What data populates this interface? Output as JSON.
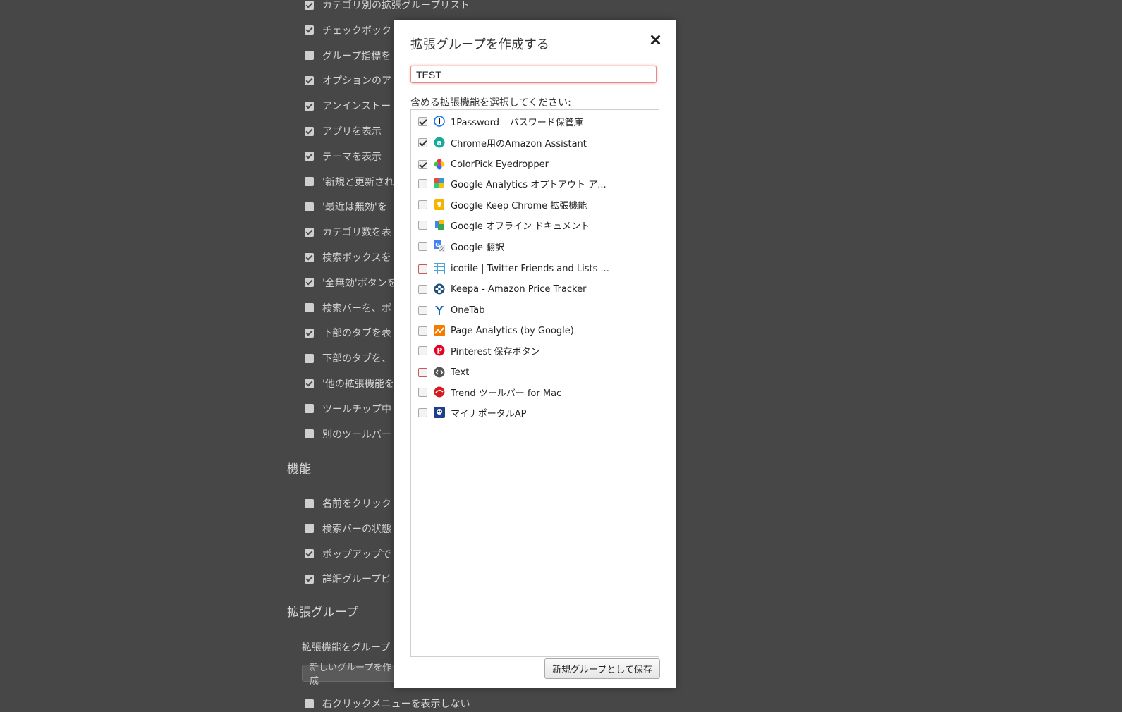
{
  "background": {
    "rows_top": [
      {
        "label": "カテゴリ別の拡張グループリスト",
        "checked": true
      },
      {
        "label": "チェックボック",
        "checked": true
      },
      {
        "label": "グループ指標を",
        "checked": false
      },
      {
        "label": "オプションのア",
        "checked": true
      },
      {
        "label": "アンインストー",
        "checked": true
      },
      {
        "label": "アプリを表示",
        "checked": true
      },
      {
        "label": "テーマを表示",
        "checked": true
      },
      {
        "label": "'新規と更新され",
        "checked": false
      },
      {
        "label": "'最近は無効'を",
        "checked": false
      },
      {
        "label": "カテゴリ数を表",
        "checked": true
      },
      {
        "label": "検索ボックスを",
        "checked": true
      },
      {
        "label": "'全無効'ボタンを",
        "checked": true
      },
      {
        "label": "検索バーを、ポ",
        "checked": false
      },
      {
        "label": "下部のタブを表",
        "checked": true
      },
      {
        "label": "下部のタブを、",
        "checked": false
      },
      {
        "label": "'他の拡張機能を",
        "checked": true
      },
      {
        "label": "ツールチップ中",
        "checked": false
      },
      {
        "label": "別のツールバー",
        "checked": false
      }
    ],
    "section_features": "機能",
    "rows_features": [
      {
        "label": "名前をクリック",
        "checked": false
      },
      {
        "label": "検索バーの状態",
        "checked": false
      },
      {
        "label": "ポップアップで",
        "checked": true
      },
      {
        "label": "詳細グループビ",
        "checked": true
      }
    ],
    "section_groups": "拡張グループ",
    "groups_description": "拡張機能をグループ",
    "new_group_button": "新しいグループを作成",
    "context_menu_row": {
      "label": "右クリックメニューを表示しない",
      "checked": false
    }
  },
  "modal": {
    "title": "拡張グループを作成する",
    "name_value": "TEST",
    "select_label": "含める拡張機能を選択してください:",
    "save_button": "新規グループとして保存",
    "extensions": [
      {
        "name": "1Password – パスワード保管庫",
        "checked": true,
        "icon": "1password-icon"
      },
      {
        "name": "Chrome用のAmazon Assistant",
        "checked": true,
        "icon": "amazon-assistant-icon"
      },
      {
        "name": "ColorPick Eyedropper",
        "checked": true,
        "icon": "colorpick-icon"
      },
      {
        "name": "Google Analytics オプトアウト ア...",
        "checked": false,
        "icon": "google-analytics-optout-icon"
      },
      {
        "name": "Google Keep Chrome 拡張機能",
        "checked": false,
        "icon": "google-keep-icon"
      },
      {
        "name": "Google オフライン ドキュメント",
        "checked": false,
        "icon": "google-docs-offline-icon"
      },
      {
        "name": "Google 翻訳",
        "checked": false,
        "icon": "google-translate-icon"
      },
      {
        "name": "icotile | Twitter Friends and Lists ...",
        "checked": false,
        "icon": "icotile-icon",
        "highlight": true
      },
      {
        "name": "Keepa - Amazon Price Tracker",
        "checked": false,
        "icon": "keepa-icon"
      },
      {
        "name": "OneTab",
        "checked": false,
        "icon": "onetab-icon"
      },
      {
        "name": "Page Analytics (by Google)",
        "checked": false,
        "icon": "page-analytics-icon"
      },
      {
        "name": "Pinterest 保存ボタン",
        "checked": false,
        "icon": "pinterest-icon"
      },
      {
        "name": "Text",
        "checked": false,
        "icon": "text-extension-icon",
        "highlight": true
      },
      {
        "name": "Trend ツールバー for Mac",
        "checked": false,
        "icon": "trend-micro-icon"
      },
      {
        "name": "マイナポータルAP",
        "checked": false,
        "icon": "mynaportal-icon"
      }
    ]
  }
}
